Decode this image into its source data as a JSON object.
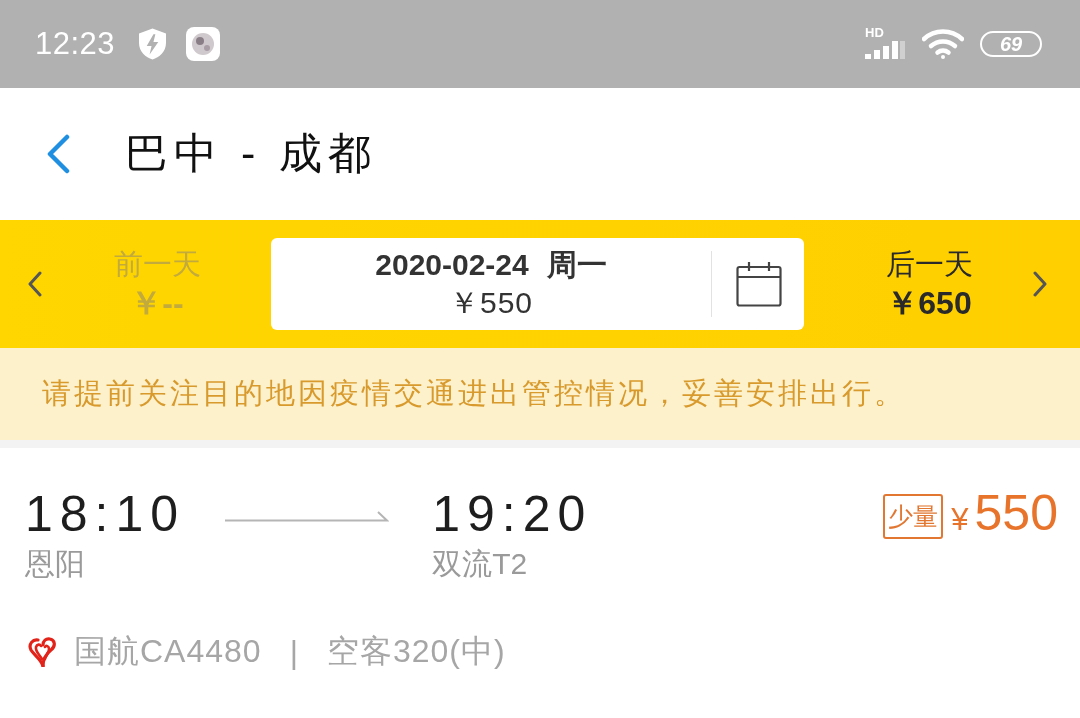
{
  "status_bar": {
    "time": "12:23",
    "network": "HD",
    "battery": "69"
  },
  "header": {
    "title": "巴中 - 成都"
  },
  "date_bar": {
    "prev_day": {
      "label": "前一天",
      "price": "￥--",
      "disabled": true
    },
    "current": {
      "date": "2020-02-24",
      "weekday": "周一",
      "price": "￥550"
    },
    "next_day": {
      "label": "后一天",
      "price": "￥650",
      "disabled": false
    }
  },
  "notice": "请提前关注目的地因疫情交通进出管控情况，妥善安排出行。",
  "flights": [
    {
      "depart_time": "18:10",
      "depart_airport": "恩阳",
      "arrive_time": "19:20",
      "arrive_airport": "双流T2",
      "badge": "少量",
      "currency": "¥",
      "price": "550",
      "airline": "国航CA4480",
      "separator": "|",
      "aircraft": "空客320(中)"
    }
  ]
}
